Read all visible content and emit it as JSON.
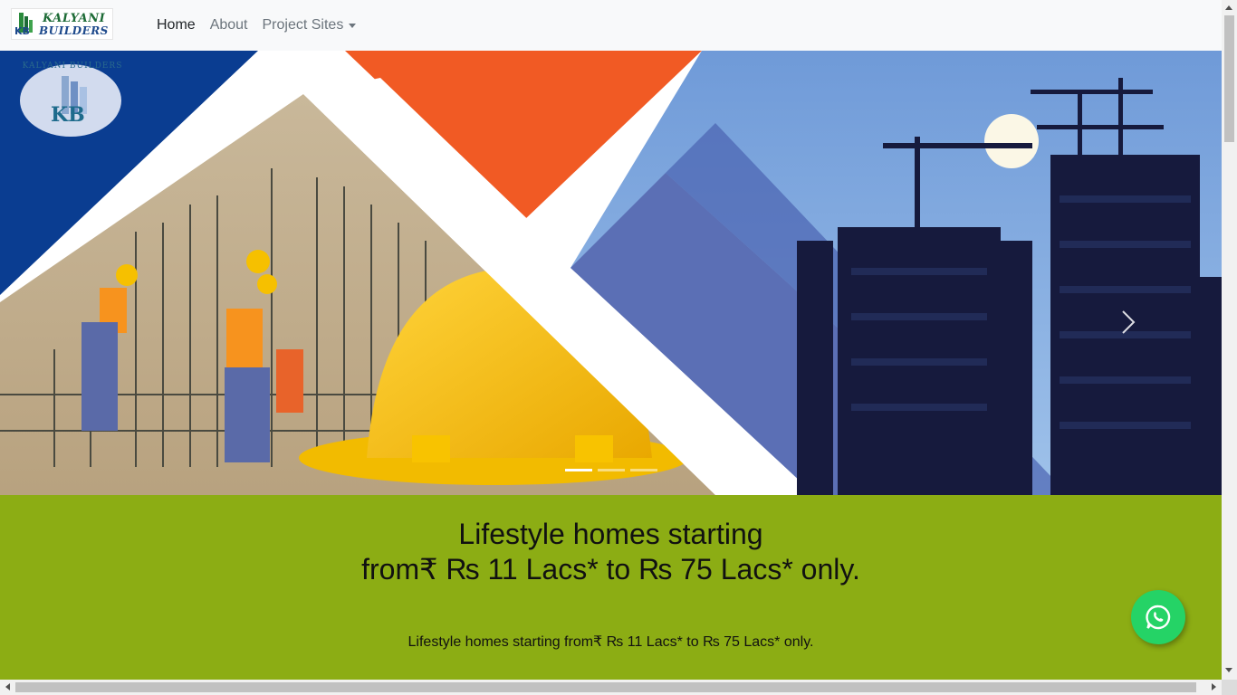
{
  "brand": {
    "line1": "KALYANI",
    "line2": "BUILDERS",
    "monogram": "KB"
  },
  "nav": {
    "items": [
      {
        "label": "Home",
        "active": true
      },
      {
        "label": "About",
        "active": false
      },
      {
        "label": "Project Sites",
        "active": false,
        "dropdown": true
      }
    ]
  },
  "carousel": {
    "badge_text": "KALYANI BUILDERS",
    "badge_monogram": "KB",
    "slide_count": 3,
    "active_slide": 1,
    "next_icon": "chevron-right-icon"
  },
  "hero": {
    "headline_line1": "Lifestyle homes starting",
    "headline_line2": "from₹ ₨ 11 Lacs* to ₨ 75 Lacs* only.",
    "subline": "Lifestyle homes starting from₹ ₨ 11 Lacs* to ₨ 75 Lacs* only."
  },
  "colors": {
    "navbar_bg": "#f8f9fa",
    "green_section": "#8cad14",
    "whatsapp": "#25d366",
    "orange": "#f15a24",
    "blue": "#0a3d91"
  },
  "whatsapp": {
    "icon": "whatsapp-icon"
  }
}
